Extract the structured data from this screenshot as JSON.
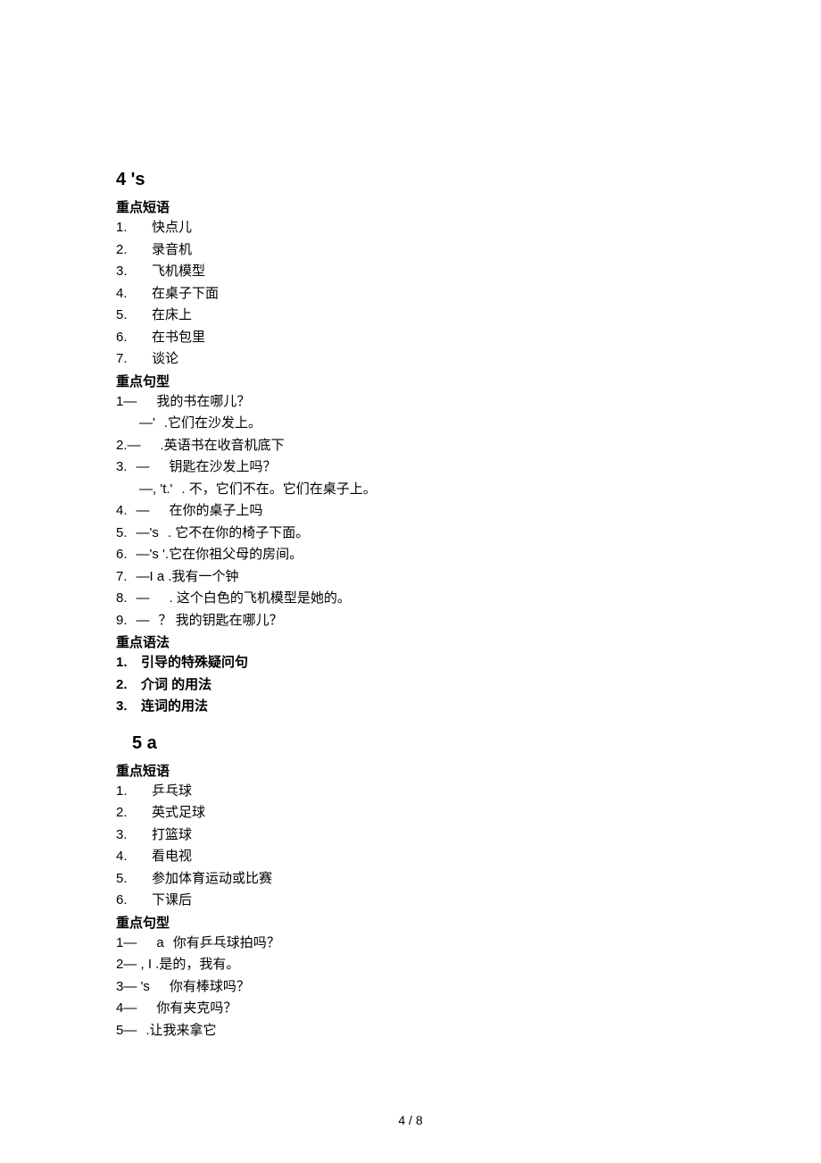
{
  "unit4": {
    "header": "4 's",
    "sections": {
      "phrases_label": "重点短语",
      "phrases": [
        {
          "num": "1.",
          "text": "快点儿"
        },
        {
          "num": "2.",
          "text": "录音机"
        },
        {
          "num": "3.",
          "text": "飞机模型"
        },
        {
          "num": "4.",
          "text": "在桌子下面"
        },
        {
          "num": "5.",
          "text": "在床上"
        },
        {
          "num": "6.",
          "text": "在书包里"
        },
        {
          "num": "7.",
          "text": "谈论"
        }
      ],
      "sentences_label": "重点句型",
      "sentences": [
        {
          "num": "1—",
          "marker": "",
          "text": "我的书在哪儿？"
        },
        {
          "num": "",
          "marker": "—'",
          "text": ".它们在沙发上。"
        },
        {
          "num": "2.—",
          "marker": "",
          "text": ".英语书在收音机底下"
        },
        {
          "num": "3.",
          "marker": "—",
          "text": "钥匙在沙发上吗？"
        },
        {
          "num": "",
          "marker": "—,   't.'",
          "text": ". 不，它们不在。它们在桌子上。"
        },
        {
          "num": "4.",
          "marker": "—",
          "text": "在你的桌子上吗"
        },
        {
          "num": "5.",
          "marker": "—'s",
          "text": ". 它不在你的椅子下面。"
        },
        {
          "num": "6.",
          "marker": "—'s    '",
          "text": ".它在你祖父母的房间。"
        },
        {
          "num": "7.",
          "marker": "—I    a",
          "text": ".我有一个钟"
        },
        {
          "num": "8.",
          "marker": "—",
          "text": ". 这个白色的飞机模型是她的。"
        },
        {
          "num": "9.",
          "marker": "—",
          "text": "？  我的钥匙在哪儿？"
        }
      ],
      "grammar_label": "重点语法",
      "grammar": [
        {
          "num": "1.",
          "text": "引导的特殊疑问句"
        },
        {
          "num": "2.",
          "text": "介词 的用法"
        },
        {
          "num": "3.",
          "text": "连词的用法"
        }
      ]
    }
  },
  "unit5": {
    "header": "5        a",
    "sections": {
      "phrases_label": "重点短语",
      "phrases": [
        {
          "num": "1.",
          "text": "乒乓球"
        },
        {
          "num": "2.",
          "text": "英式足球"
        },
        {
          "num": "3.",
          "text": "打篮球"
        },
        {
          "num": "4.",
          "text": "看电视"
        },
        {
          "num": "5.",
          "text": "参加体育运动或比赛"
        },
        {
          "num": "6.",
          "text": "下课后"
        }
      ],
      "sentences_label": "重点句型",
      "sentences": [
        {
          "num": "1—",
          "marker": "a",
          "text": "你有乒乓球拍吗？"
        },
        {
          "num": "2—",
          "marker": ", I .",
          "text": "是的，我有。"
        },
        {
          "num": "3—",
          "marker": "'s",
          "text": "你有棒球吗？"
        },
        {
          "num": "4—",
          "marker": "",
          "text": "你有夹克吗？"
        },
        {
          "num": "5—",
          "marker": "",
          "text": ".让我来拿它"
        }
      ]
    }
  },
  "footer": "4 / 8"
}
